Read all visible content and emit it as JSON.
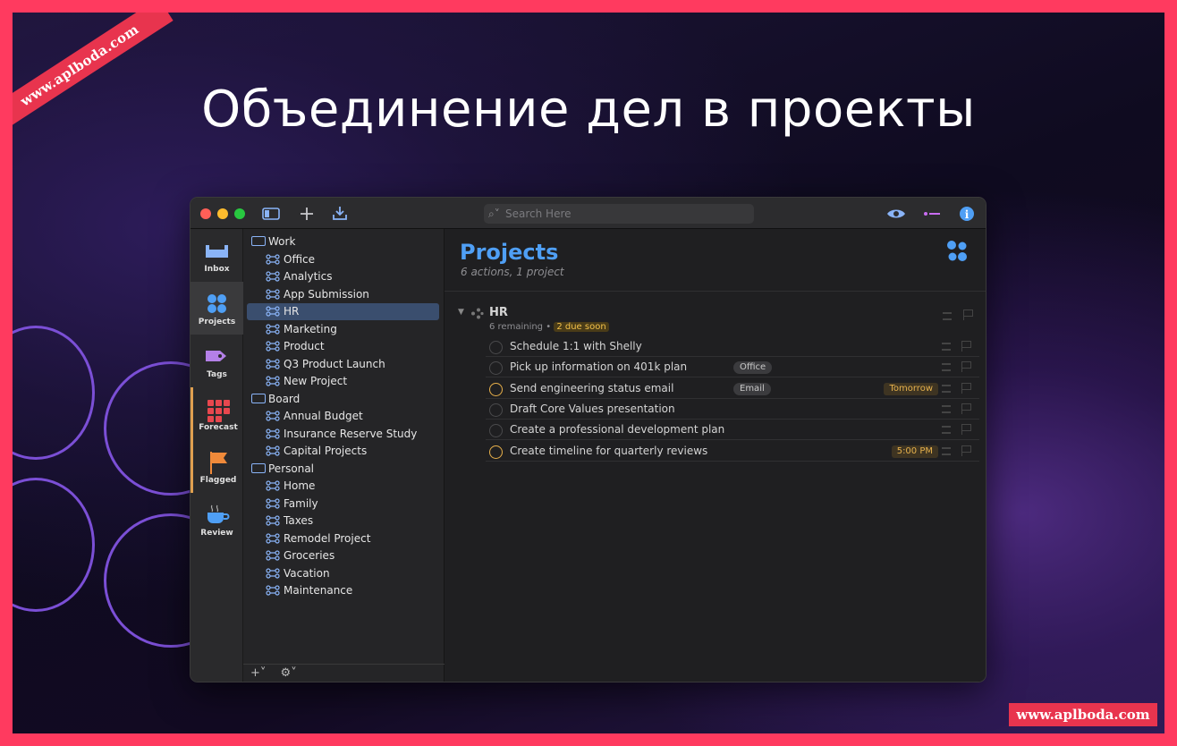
{
  "slide": {
    "title": "Объединение дел в проекты",
    "ribbon": "www.aplboda.com",
    "watermark": "www.aplboda.com"
  },
  "toolbar": {
    "search_placeholder": "Search Here"
  },
  "sidebar": [
    {
      "label": "Inbox",
      "icon": "inbox-icon"
    },
    {
      "label": "Projects",
      "icon": "projects-icon"
    },
    {
      "label": "Tags",
      "icon": "tag-icon"
    },
    {
      "label": "Forecast",
      "icon": "forecast-icon"
    },
    {
      "label": "Flagged",
      "icon": "flag-icon"
    },
    {
      "label": "Review",
      "icon": "review-icon"
    }
  ],
  "projects": {
    "folders": [
      {
        "name": "Work",
        "items": [
          "Office",
          "Analytics",
          "App Submission",
          "HR",
          "Marketing",
          "Product",
          "Q3 Product Launch",
          "New Project"
        ]
      },
      {
        "name": "Board",
        "items": [
          "Annual Budget",
          "Insurance Reserve Study",
          "Capital Projects"
        ]
      },
      {
        "name": "Personal",
        "items": [
          "Home",
          "Family",
          "Taxes",
          "Remodel Project",
          "Groceries",
          "Vacation",
          "Maintenance"
        ]
      }
    ],
    "selected": "HR",
    "bottom": {
      "add": "+˅",
      "gear": "⚙˅"
    }
  },
  "main": {
    "title": "Projects",
    "subtitle": "6 actions, 1 project",
    "group": {
      "title": "HR",
      "remaining": "6 remaining",
      "sep": "•",
      "due": "2 due soon"
    },
    "rows": [
      {
        "text": "Schedule 1:1 with Shelly",
        "tag": "",
        "date": "",
        "due": false
      },
      {
        "text": "Pick up information on 401k plan",
        "tag": "Office",
        "date": "",
        "due": false
      },
      {
        "text": "Send engineering status email",
        "tag": "Email",
        "date": "Tomorrow",
        "due": true
      },
      {
        "text": "Draft Core Values presentation",
        "tag": "",
        "date": "",
        "due": false
      },
      {
        "text": "Create a professional development plan",
        "tag": "",
        "date": "",
        "due": false
      },
      {
        "text": "Create timeline for quarterly reviews",
        "tag": "",
        "date": "5:00 PM",
        "due": true
      }
    ]
  },
  "colors": {
    "accent": "#4f9ff5",
    "due": "#e8b04a",
    "frame": "#ff3a5f"
  }
}
